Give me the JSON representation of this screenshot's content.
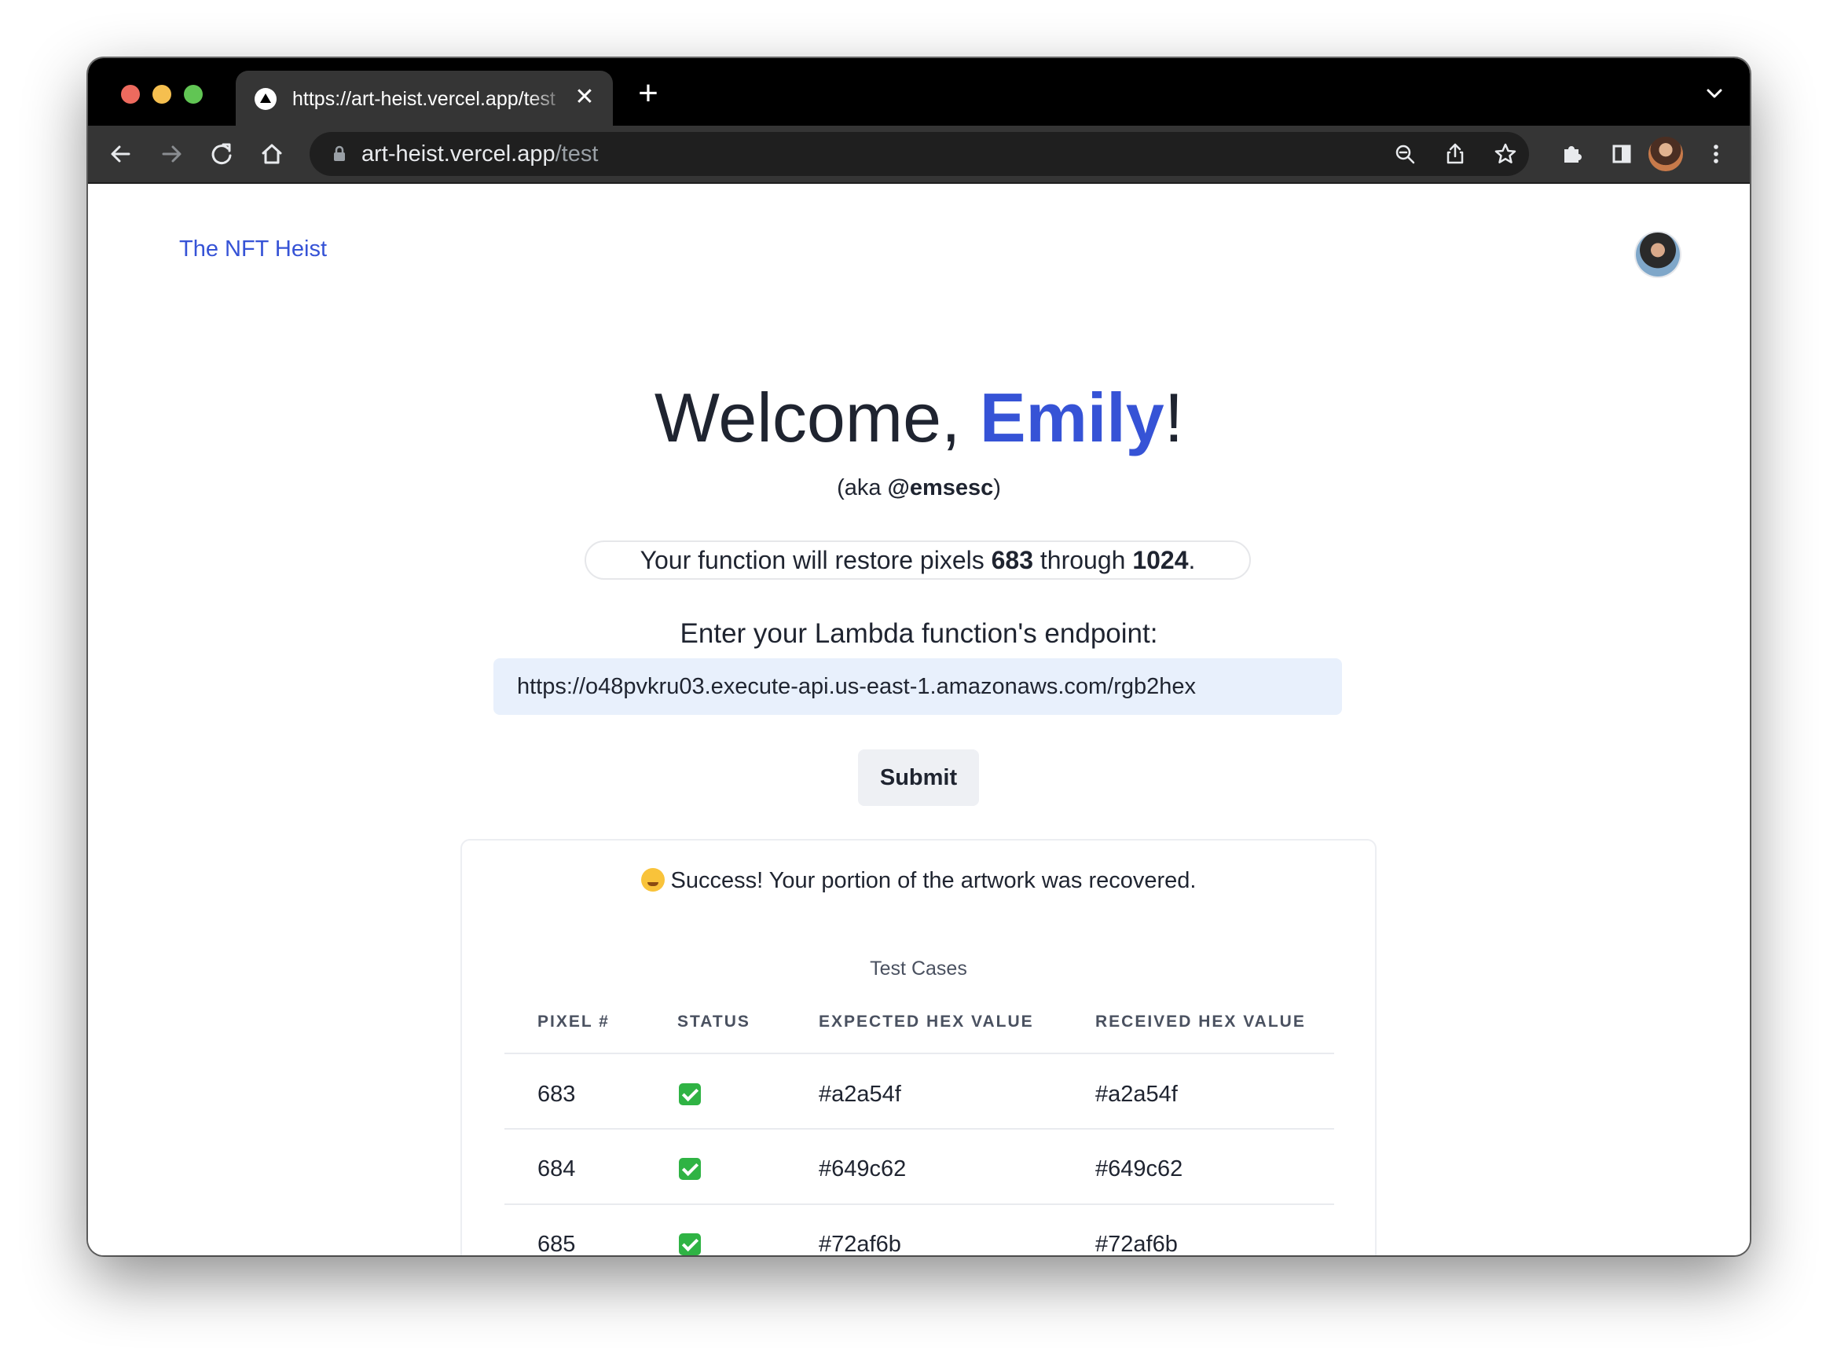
{
  "browser": {
    "tab_title": "https://art-heist.vercel.app/test",
    "tab_close": "✕",
    "new_tab": "+",
    "url_host": "art-heist.vercel.app",
    "url_path": "/test"
  },
  "header": {
    "site_title": "The NFT Heist"
  },
  "welcome": {
    "prefix": "Welcome, ",
    "name": "Emily",
    "suffix": "!",
    "aka_prefix": "(aka ",
    "handle": "@emsesc",
    "aka_suffix": ")"
  },
  "range": {
    "prefix": "Your function will restore pixels ",
    "start": "683",
    "middle": " through ",
    "end": "1024",
    "suffix": "."
  },
  "form": {
    "label": "Enter your Lambda function's endpoint:",
    "endpoint_value": "https://o48pvkru03.execute-api.us-east-1.amazonaws.com/rgb2hex",
    "submit_label": "Submit"
  },
  "result": {
    "success_text": "Success! Your portion of the artwork was recovered.",
    "emoji_icon": "partying-face-icon",
    "caption": "Test Cases",
    "columns": [
      "PIXEL #",
      "STATUS",
      "EXPECTED HEX VALUE",
      "RECEIVED HEX VALUE"
    ],
    "rows": [
      {
        "pixel": "683",
        "status": "pass",
        "expected": "#a2a54f",
        "received": "#a2a54f"
      },
      {
        "pixel": "684",
        "status": "pass",
        "expected": "#649c62",
        "received": "#649c62"
      },
      {
        "pixel": "685",
        "status": "pass",
        "expected": "#72af6b",
        "received": "#72af6b"
      }
    ]
  },
  "colors": {
    "accent": "#3653d6",
    "input_bg": "#e8f0fc",
    "status_pass": "#2fb344"
  }
}
